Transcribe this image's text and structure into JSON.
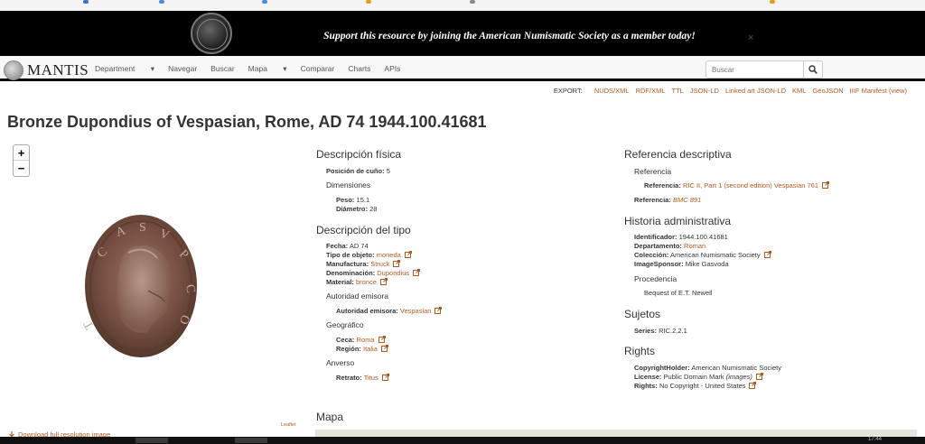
{
  "banner": {
    "text": "Support this resource by joining the American Numismatic Society as a member today!",
    "close": "×"
  },
  "navbar": {
    "brand": "MANTIS",
    "items": [
      "Department",
      "Navegar",
      "Buscar",
      "Mapa",
      "Comparar",
      "Charts",
      "APIs"
    ],
    "search_placeholder": "Buscar"
  },
  "export": {
    "label": "EXPORT:",
    "links": [
      "NUDS/XML",
      "RDF/XML",
      "TTL",
      "JSON-LD",
      "Linked art JSON-LD",
      "KML",
      "GeoJSON",
      "IIIF Manifest (view)"
    ]
  },
  "title": "Bronze Dupondius of Vespasian, Rome, AD 74 1944.100.41681",
  "map_controls": {
    "zoom_in": "+",
    "zoom_out": "−",
    "attribution": "Leaflet"
  },
  "download": "Download full resolution image",
  "physical": {
    "heading": "Descripción física",
    "axis_label": "Posición de cuño:",
    "axis_value": "5",
    "dimensions": "Dimensiones",
    "weight_label": "Peso:",
    "weight_value": "15.1",
    "diameter_label": "Diámetro:",
    "diameter_value": "28"
  },
  "typology": {
    "heading": "Descripción del tipo",
    "date_label": "Fecha:",
    "date_value": "AD 74",
    "objecttype_label": "Tipo de objeto:",
    "objecttype_value": "moneda",
    "manufacture_label": "Manufactura:",
    "manufacture_value": "Struck",
    "denomination_label": "Denominación:",
    "denomination_value": "Dupondius",
    "material_label": "Material:",
    "material_value": "bronce",
    "authority_heading": "Autoridad emisora",
    "authority_label": "Autoridad emisora:",
    "authority_value": "Vespasian",
    "geo_heading": "Geográfico",
    "mint_label": "Ceca:",
    "mint_value": "Roma",
    "region_label": "Región:",
    "region_value": "Italia",
    "obverse_heading": "Anverso",
    "portrait_label": "Retrato:",
    "portrait_value": "Titus"
  },
  "map_heading": "Mapa",
  "reference": {
    "heading": "Referencia descriptiva",
    "sub": "Referencia",
    "ref1_label": "Referencia:",
    "ref1_value": "RIC II, Part 1 (second edition) Vespasian 761",
    "ref2_label": "Referencia:",
    "ref2_value": "BMC 891"
  },
  "admin": {
    "heading": "Historia administrativa",
    "id_label": "Identificador:",
    "id_value": "1944.100.41681",
    "dept_label": "Departamento:",
    "dept_value": "Roman",
    "collection_label": "Colección:",
    "collection_value": "American Numismatic Society",
    "sponsor_label": "ImageSponsor:",
    "sponsor_value": "Mike Gasvoda",
    "provenance_heading": "Procedencia",
    "provenance_value": "Bequest of E.T. Newell"
  },
  "subjects": {
    "heading": "Sujetos",
    "series_label": "Series:",
    "series_value": "RIC.2.2.1"
  },
  "rights": {
    "heading": "Rights",
    "holder_label": "CopyrightHolder:",
    "holder_value": "American Numismatic Society",
    "license_label": "License:",
    "license_value": "Public Domain Mark",
    "license_extra": "(images)",
    "rights_label": "Rights:",
    "rights_value": "No Copyright - United States"
  },
  "taskbar": {
    "clock": "17:44"
  },
  "colors": {
    "link": "#b35a1f",
    "banner_bg": "#000000"
  }
}
